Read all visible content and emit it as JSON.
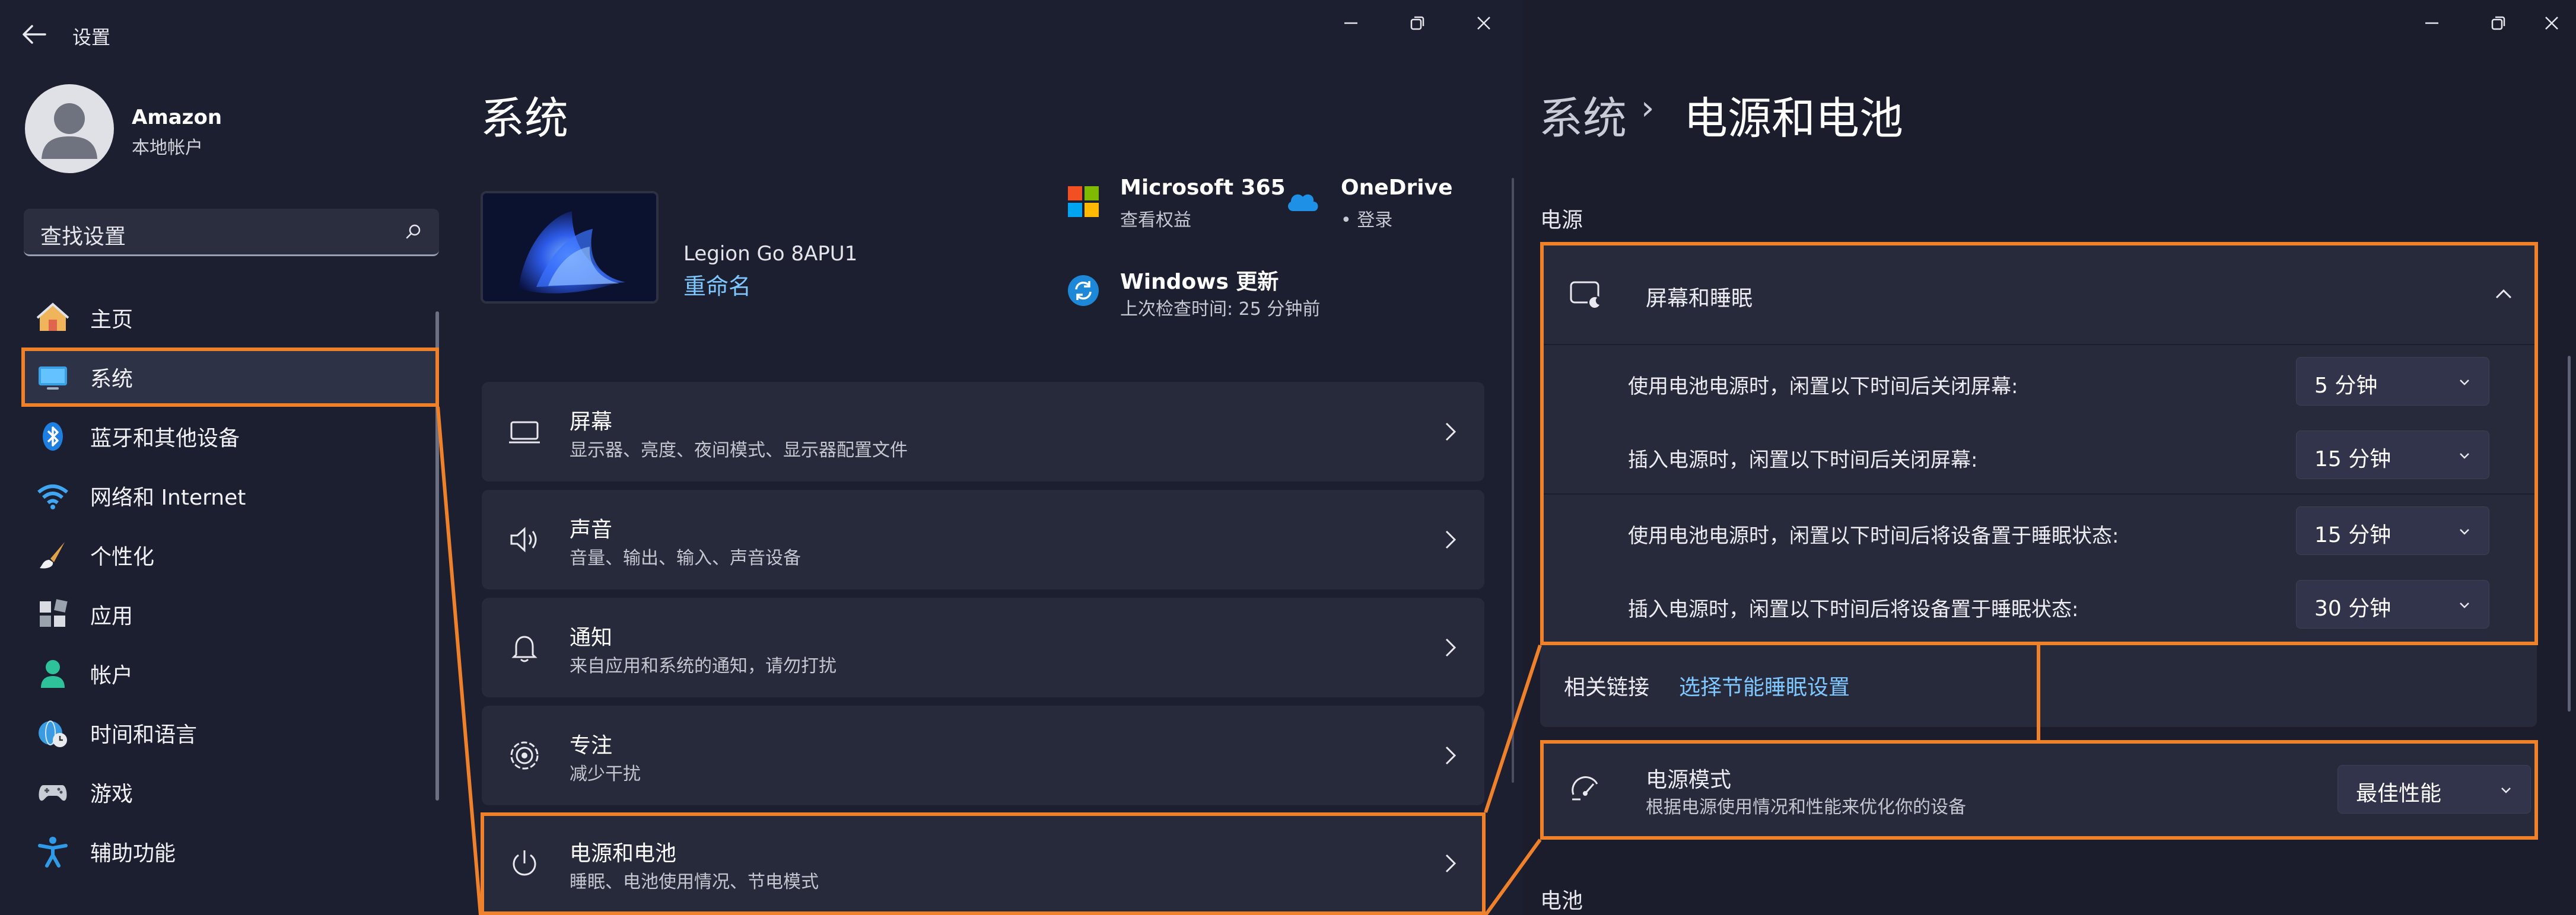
{
  "left_window": {
    "title": "设置",
    "user": {
      "name": "Amazon",
      "account_type": "本地帐户"
    },
    "search": {
      "placeholder": "查找设置"
    },
    "nav": [
      {
        "label": "主页",
        "icon": "home-icon"
      },
      {
        "label": "系统",
        "icon": "system-icon",
        "selected": true
      },
      {
        "label": "蓝牙和其他设备",
        "icon": "bluetooth-icon"
      },
      {
        "label": "网络和 Internet",
        "icon": "wifi-icon"
      },
      {
        "label": "个性化",
        "icon": "brush-icon"
      },
      {
        "label": "应用",
        "icon": "apps-icon"
      },
      {
        "label": "帐户",
        "icon": "account-icon"
      },
      {
        "label": "时间和语言",
        "icon": "globe-clock-icon"
      },
      {
        "label": "游戏",
        "icon": "gamepad-icon"
      },
      {
        "label": "辅助功能",
        "icon": "accessibility-icon"
      }
    ],
    "page_title": "系统",
    "device": {
      "name": "Legion Go 8APU1",
      "rename_link": "重命名"
    },
    "services": {
      "m365": {
        "title": "Microsoft 365",
        "subtitle": "查看权益"
      },
      "onedrive": {
        "title": "OneDrive",
        "subtitle": "• 登录"
      },
      "update": {
        "title": "Windows 更新",
        "subtitle": "上次检查时间: 25 分钟前"
      }
    },
    "cards": [
      {
        "title": "屏幕",
        "subtitle": "显示器、亮度、夜间模式、显示器配置文件",
        "icon": "display-icon"
      },
      {
        "title": "声音",
        "subtitle": "音量、输出、输入、声音设备",
        "icon": "speaker-icon"
      },
      {
        "title": "通知",
        "subtitle": "来自应用和系统的通知，请勿打扰",
        "icon": "bell-icon"
      },
      {
        "title": "专注",
        "subtitle": "减少干扰",
        "icon": "focus-icon"
      },
      {
        "title": "电源和电池",
        "subtitle": "睡眠、电池使用情况、节电模式",
        "icon": "power-icon"
      }
    ]
  },
  "right_window": {
    "breadcrumb_parent": "系统",
    "breadcrumb_sep": "›",
    "page_title": "电源和电池",
    "section_power": "电源",
    "screen_sleep": {
      "title": "屏幕和睡眠",
      "rows": [
        {
          "label": "使用电池电源时，闲置以下时间后关闭屏幕:",
          "value": "5 分钟"
        },
        {
          "label": "插入电源时，闲置以下时间后关闭屏幕:",
          "value": "15 分钟"
        },
        {
          "label": "使用电池电源时，闲置以下时间后将设备置于睡眠状态:",
          "value": "15 分钟"
        },
        {
          "label": "插入电源时，闲置以下时间后将设备置于睡眠状态:",
          "value": "30 分钟"
        }
      ]
    },
    "related": {
      "label": "相关链接",
      "link": "选择节能睡眠设置"
    },
    "power_mode": {
      "title": "电源模式",
      "subtitle": "根据电源使用情况和性能来优化你的设备",
      "value": "最佳性能"
    },
    "section_battery": "电池"
  },
  "colors": {
    "accent_link": "#7fc7ff",
    "highlight": "#f0812b",
    "background": "#1b1d2d",
    "card": "#272a3b"
  }
}
